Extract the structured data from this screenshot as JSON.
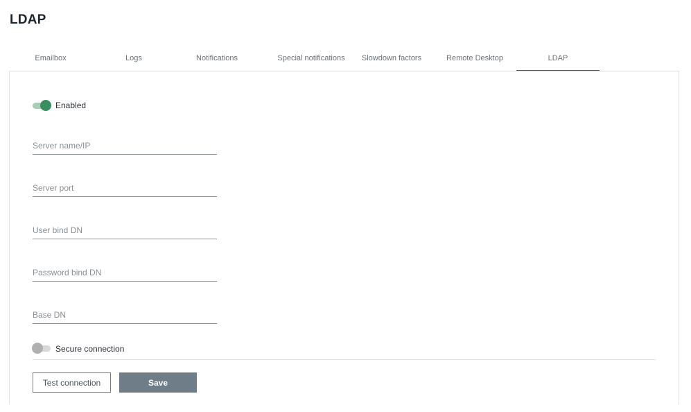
{
  "page": {
    "title": "LDAP"
  },
  "tabs": [
    {
      "label": "Emailbox",
      "active": false
    },
    {
      "label": "Logs",
      "active": false
    },
    {
      "label": "Notifications",
      "active": false
    },
    {
      "label": "Special notifications",
      "active": false
    },
    {
      "label": "Slowdown factors",
      "active": false
    },
    {
      "label": "Remote Desktop",
      "active": false
    },
    {
      "label": "LDAP",
      "active": true
    }
  ],
  "form": {
    "enabled": {
      "label": "Enabled",
      "on": true
    },
    "server_name": {
      "placeholder": "Server name/IP",
      "value": ""
    },
    "server_port": {
      "placeholder": "Server port",
      "value": ""
    },
    "user_bind_dn": {
      "placeholder": "User bind DN",
      "value": ""
    },
    "password_bind_dn": {
      "placeholder": "Password bind DN",
      "value": ""
    },
    "base_dn": {
      "placeholder": "Base DN",
      "value": ""
    },
    "secure_connection": {
      "label": "Secure connection",
      "on": false
    }
  },
  "actions": {
    "test_label": "Test connection",
    "save_label": "Save"
  },
  "colors": {
    "toggle_on": "#3a8f5e",
    "toggle_off": "#b0b0b0",
    "save_button": "#6f7d89",
    "active_tab_underline": "#4a5b6e"
  }
}
